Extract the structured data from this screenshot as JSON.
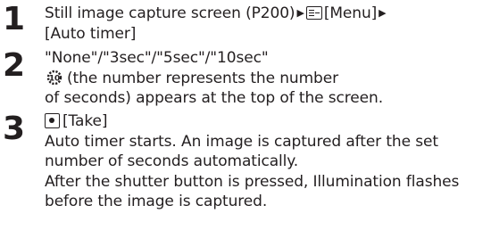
{
  "steps": [
    {
      "number": "1",
      "path": {
        "screen": "Still image capture screen (P200)",
        "menu_key_label": "[Menu]",
        "item": "[Auto timer]"
      }
    },
    {
      "number": "2",
      "options": "\"None\"/\"3sec\"/\"5sec\"/\"10sec\"",
      "icon": "auto-timer-icon",
      "desc_line1": "(the number represents the number",
      "desc_line2": "of seconds) appears at the top of the screen."
    },
    {
      "number": "3",
      "take_label": "[Take]",
      "lines": [
        "Auto timer starts. An image is captured after the set",
        "number of seconds automatically.",
        "After the shutter button is pressed, Illumination flashes",
        "before the image is captured."
      ]
    }
  ]
}
